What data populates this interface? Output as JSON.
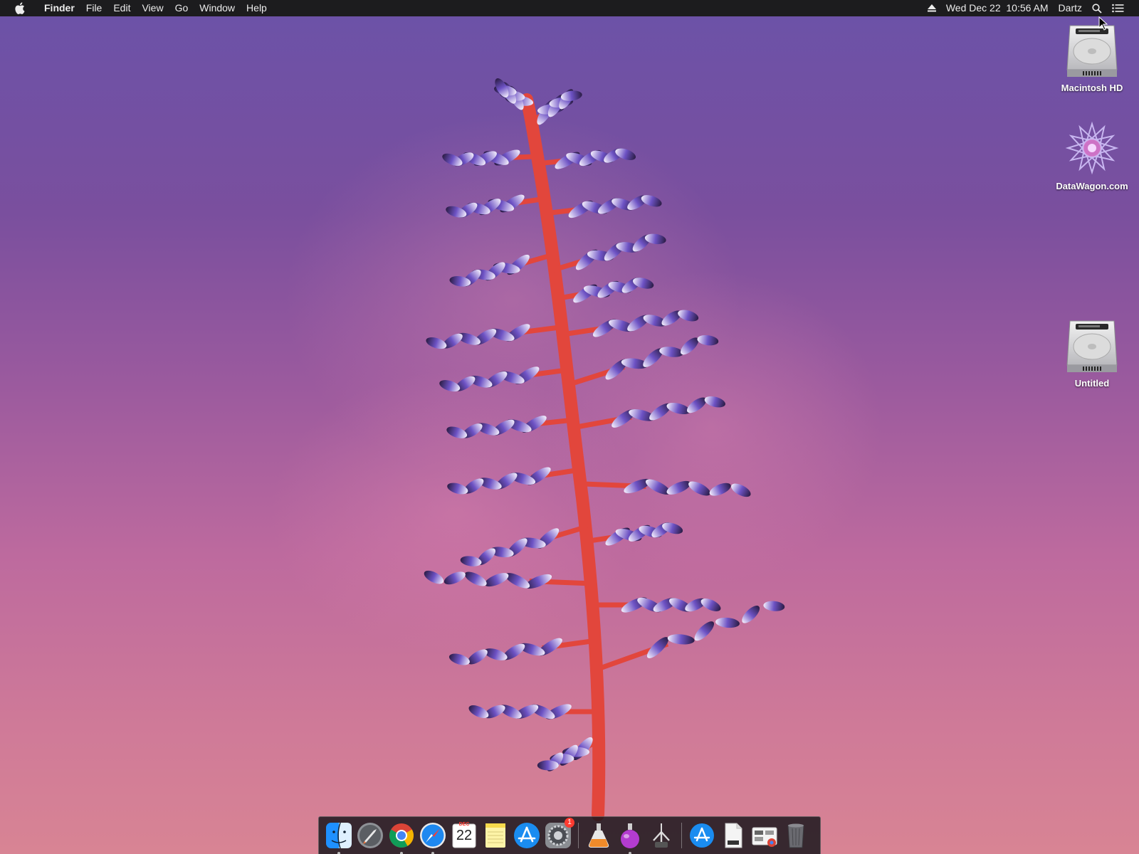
{
  "menubar": {
    "items": [
      "Finder",
      "File",
      "Edit",
      "View",
      "Go",
      "Window",
      "Help"
    ],
    "datetime": "Wed Dec 22  10:56 AM",
    "user": "Dartz"
  },
  "desktop_icons": [
    {
      "label": "Macintosh HD",
      "icon": "hard-drive-icon"
    },
    {
      "label": "DataWagon.com",
      "icon": "datawagon-icon"
    },
    {
      "label": "Untitled",
      "icon": "hard-drive-icon"
    }
  ],
  "dock": {
    "items": [
      {
        "icon": "finder-icon",
        "running": true
      },
      {
        "icon": "launchpad-icon",
        "running": false
      },
      {
        "icon": "chrome-icon",
        "running": true
      },
      {
        "icon": "safari-icon",
        "running": true
      },
      {
        "icon": "calendar-icon",
        "running": false
      },
      {
        "icon": "notes-icon",
        "running": false
      },
      {
        "icon": "app-store-icon",
        "running": false
      },
      {
        "icon": "system-preferences-icon",
        "running": false
      },
      {
        "icon": "installer-flask-icon",
        "running": false
      },
      {
        "icon": "potion-icon",
        "running": true
      },
      {
        "icon": "grabber-icon",
        "running": false
      },
      {
        "icon": "app-store-downloads-icon",
        "running": false
      },
      {
        "icon": "document-icon",
        "running": false
      },
      {
        "icon": "chrome-apps-folder-icon",
        "running": false
      },
      {
        "icon": "trash-icon",
        "running": false
      }
    ],
    "calendar": {
      "month": "DEC",
      "day": "22"
    },
    "system_preferences_badge": "1"
  },
  "colors": {
    "menubar_bg": "#1c1c1e",
    "wallpaper_top": "#6b52a8",
    "wallpaper_bottom": "#d88494",
    "stem": "#e2463c",
    "badge": "#ff3b30"
  }
}
